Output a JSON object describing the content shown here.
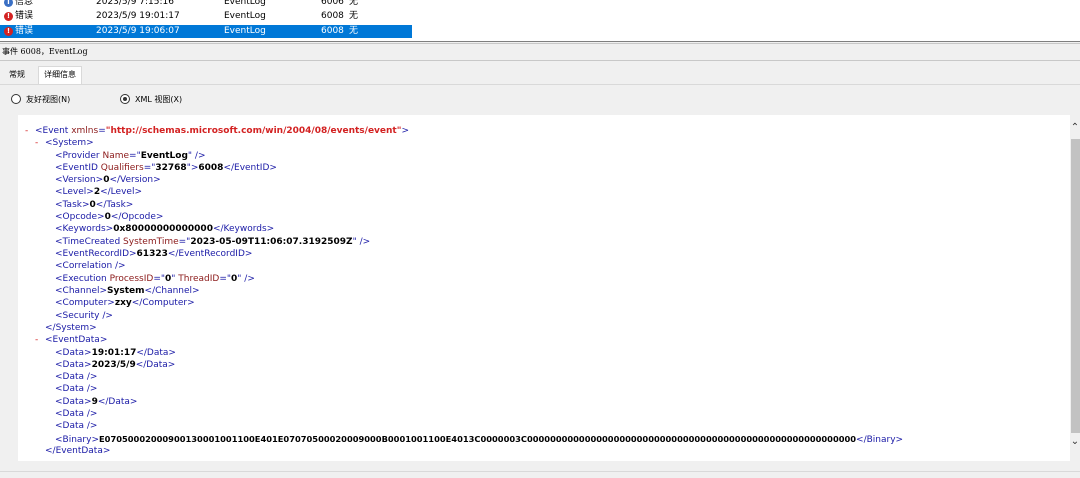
{
  "events": [
    {
      "level": "信息",
      "level_type": "info",
      "date": "2023/5/9 7:15:16",
      "source": "EventLog",
      "id": "6006",
      "task": "无",
      "selected": false
    },
    {
      "level": "错误",
      "level_type": "error",
      "date": "2023/5/9 19:01:17",
      "source": "EventLog",
      "id": "6008",
      "task": "无",
      "selected": false
    },
    {
      "level": "错误",
      "level_type": "error",
      "date": "2023/5/9 19:06:07",
      "source": "EventLog",
      "id": "6008",
      "task": "无",
      "selected": true
    }
  ],
  "detail": {
    "title_prefix": "事件",
    "title_rest": " 6008，EventLog",
    "tabs": {
      "general": "常规",
      "details": "详细信息"
    },
    "views": {
      "friendly": "友好视图(N)",
      "xml": "XML 视图(X)"
    }
  },
  "xml": {
    "event_open_toggle": "-",
    "event_ns_value": "http://schemas.microsoft.com/win/2004/08/events/event",
    "provider_name": "EventLog",
    "event_id_qualifiers": "32768",
    "event_id": "6008",
    "version": "0",
    "level": "2",
    "task": "0",
    "opcode": "0",
    "keywords": "0x80000000000000",
    "time_created": "2023-05-09T11:06:07.3192509Z",
    "event_record_id": "61323",
    "process_id": "0",
    "thread_id": "0",
    "channel": "System",
    "computer": "zxy",
    "data": [
      "19:01:17",
      "2023/5/9",
      "",
      "",
      "9",
      "",
      ""
    ],
    "binary": "E07050002000900130001001100E401E07070500020009000B0001001100E4013C0000003C000000000000000000000000000000000000000000000000000000000"
  },
  "colors": {
    "selection": "#0078d7",
    "tag": "#1a1aa6",
    "attr": "#8b1a1a",
    "toggle": "#d32222"
  }
}
